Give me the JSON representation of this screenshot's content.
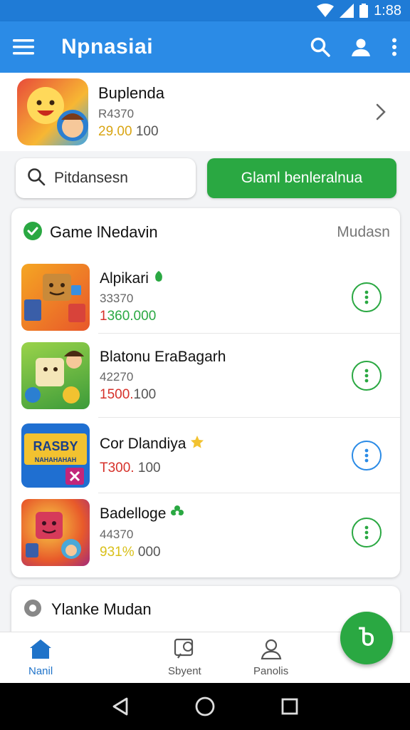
{
  "status_bar": {
    "time": "1:88"
  },
  "app_bar": {
    "title": "Npnasiai"
  },
  "featured": {
    "name": "Buplenda",
    "sub": "R4370",
    "price_a": "29.00",
    "price_b": "100"
  },
  "search": {
    "placeholder": "Pitdansesn"
  },
  "action_button": {
    "label": "Glaml benleralnua"
  },
  "game_list": {
    "title": "Game lNedavin",
    "more": "Mudasn",
    "items": [
      {
        "name": "Alpikari",
        "sub": "33370",
        "price_a": "1",
        "price_b": "360.000",
        "price_a_color": "#d6312a",
        "price_b_color": "#2aa842"
      },
      {
        "name": "Blatonu EraBagarh",
        "sub": "42270",
        "price_a": "1500.",
        "price_b": "100",
        "price_a_color": "#d6312a",
        "price_b_color": "#555555"
      },
      {
        "name": "Cor Dlandiya",
        "sub": "",
        "price_a": "T300.",
        "price_b": "100",
        "price_a_color": "#d6312a",
        "price_b_color": "#555555"
      },
      {
        "name": "Badelloge",
        "sub": "44370",
        "price_a": "931%",
        "price_b": "000",
        "price_a_color": "#d9c01a",
        "price_b_color": "#555555"
      }
    ]
  },
  "section2": {
    "title": "Ylanke Mudan"
  },
  "fab": {
    "label": "Ⴆ"
  },
  "bottom_nav": {
    "items": [
      {
        "label": "Nanil"
      },
      {
        "label": "Sbyent"
      },
      {
        "label": "Panolis"
      }
    ]
  },
  "colors": {
    "primary": "#2b8be6",
    "green": "#2aa842",
    "status_bar": "#1f7bd6"
  }
}
